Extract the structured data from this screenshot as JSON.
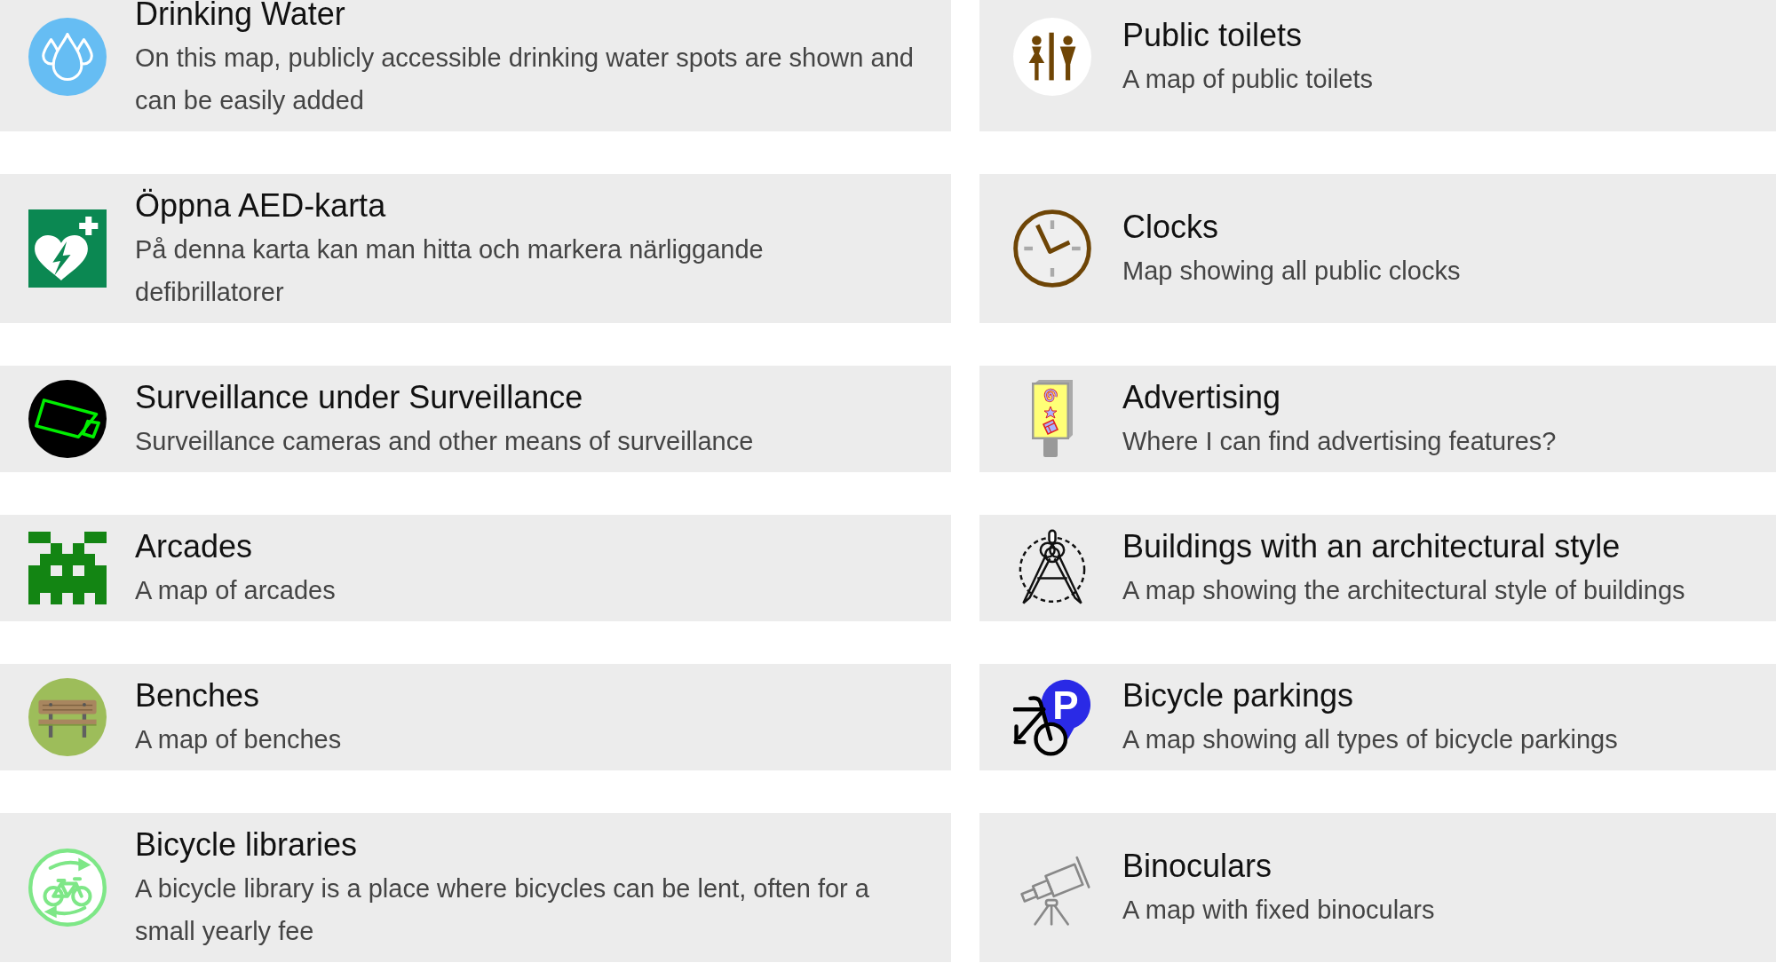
{
  "themes": [
    {
      "kind": "water",
      "title": "Drinking Water",
      "description": "On this map, publicly accessible drinking water spots are shown and can be easily added"
    },
    {
      "kind": "toilets",
      "title": "Public toilets",
      "description": "A map of public toilets"
    },
    {
      "kind": "aed",
      "title": "Öppna AED-karta",
      "description": "På denna karta kan man hitta och markera närliggande defibrillatorer"
    },
    {
      "kind": "clock",
      "title": "Clocks",
      "description": "Map showing all public clocks"
    },
    {
      "kind": "camera",
      "title": "Surveillance under Surveillance",
      "description": "Surveillance cameras and other means of surveillance"
    },
    {
      "kind": "advert",
      "title": "Advertising",
      "description": "Where I can find advertising features?"
    },
    {
      "kind": "arcade",
      "title": "Arcades",
      "description": "A map of arcades"
    },
    {
      "kind": "compass",
      "title": "Buildings with an architectural style",
      "description": "A map showing the architectural style of buildings"
    },
    {
      "kind": "bench",
      "title": "Benches",
      "description": "A map of benches"
    },
    {
      "kind": "bikeparking",
      "title": "Bicycle parkings",
      "description": "A map showing all types of bicycle parkings",
      "icon_letter": "P"
    },
    {
      "kind": "bikelibrary",
      "title": "Bicycle libraries",
      "description": "A bicycle library is a place where bicycles can be lent, often for a small yearly fee"
    },
    {
      "kind": "telescope",
      "title": "Binoculars",
      "description": "A map with fixed binoculars"
    }
  ]
}
